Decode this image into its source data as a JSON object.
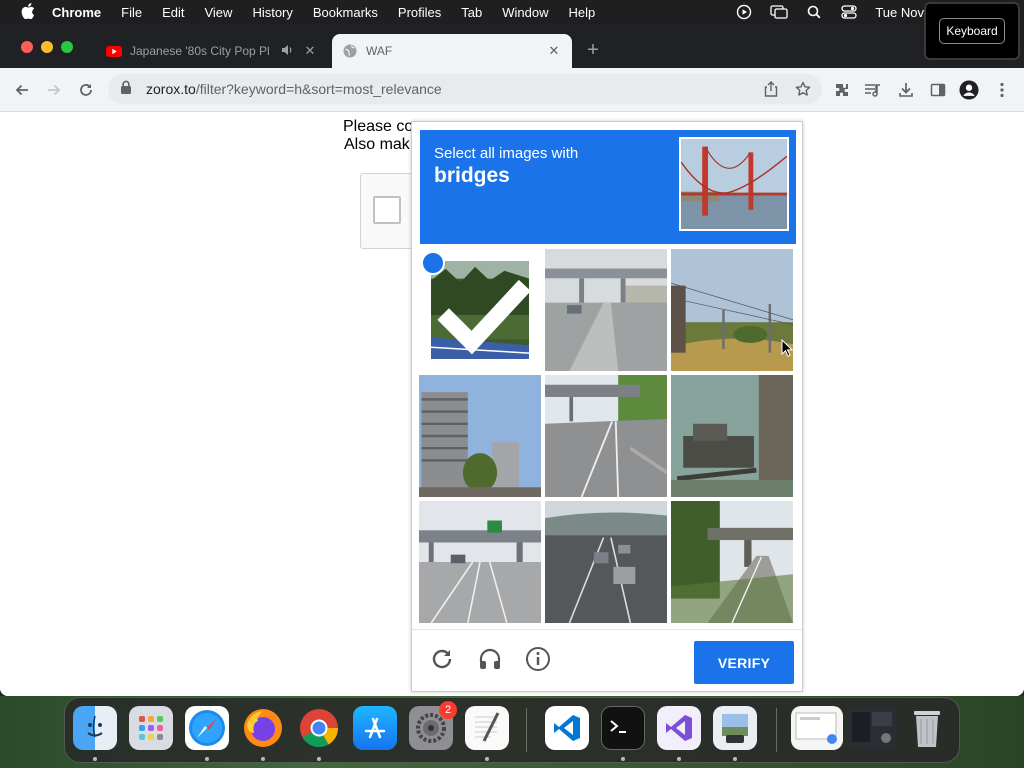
{
  "menubar": {
    "app_name": "Chrome",
    "items": [
      "File",
      "Edit",
      "View",
      "History",
      "Bookmarks",
      "Profiles",
      "Tab",
      "Window",
      "Help"
    ],
    "clock": "Tue Nov"
  },
  "keyboard_overlay": {
    "label": "Keyboard"
  },
  "tabs": [
    {
      "title": "Japanese '80s City Pop Pl",
      "favicon": "youtube-icon",
      "audio": true
    },
    {
      "title": "WAF",
      "favicon": "globe-icon",
      "active": true
    }
  ],
  "address_bar": {
    "host": "zorox.to",
    "path": "/filter?keyword=h&sort=most_relevance"
  },
  "page": {
    "line1": "Please co",
    "line2": "Also mak"
  },
  "captcha": {
    "instruction": "Select all images with",
    "target": "bridges",
    "tiles": [
      {
        "scene": "forest road",
        "selected": true
      },
      {
        "scene": "highway with overpass",
        "selected": false
      },
      {
        "scene": "power lines over field",
        "selected": false
      },
      {
        "scene": "apartment buildings",
        "selected": false
      },
      {
        "scene": "highway under bridge",
        "selected": false
      },
      {
        "scene": "abandoned machinery",
        "selected": false
      },
      {
        "scene": "highway with sign gantry",
        "selected": false
      },
      {
        "scene": "highway traffic",
        "selected": false
      },
      {
        "scene": "road under bridge",
        "selected": false
      }
    ],
    "verify_label": "VERIFY"
  },
  "dock": {
    "items": [
      "finder-icon",
      "launchpad-icon",
      "safari-icon",
      "firefox-icon",
      "chrome-icon",
      "app-store-icon",
      "system-settings-icon",
      "textedit-icon",
      "vscode-icon",
      "terminal-icon",
      "visual-studio-icon",
      "preview-icon",
      "screenshot-thumb-1",
      "screenshot-thumb-2",
      "trash-icon"
    ],
    "settings_badge": "2"
  },
  "colors": {
    "accent": "#1a73e8",
    "tabstrip": "#202124",
    "toolbar": "#f1f3f4"
  }
}
